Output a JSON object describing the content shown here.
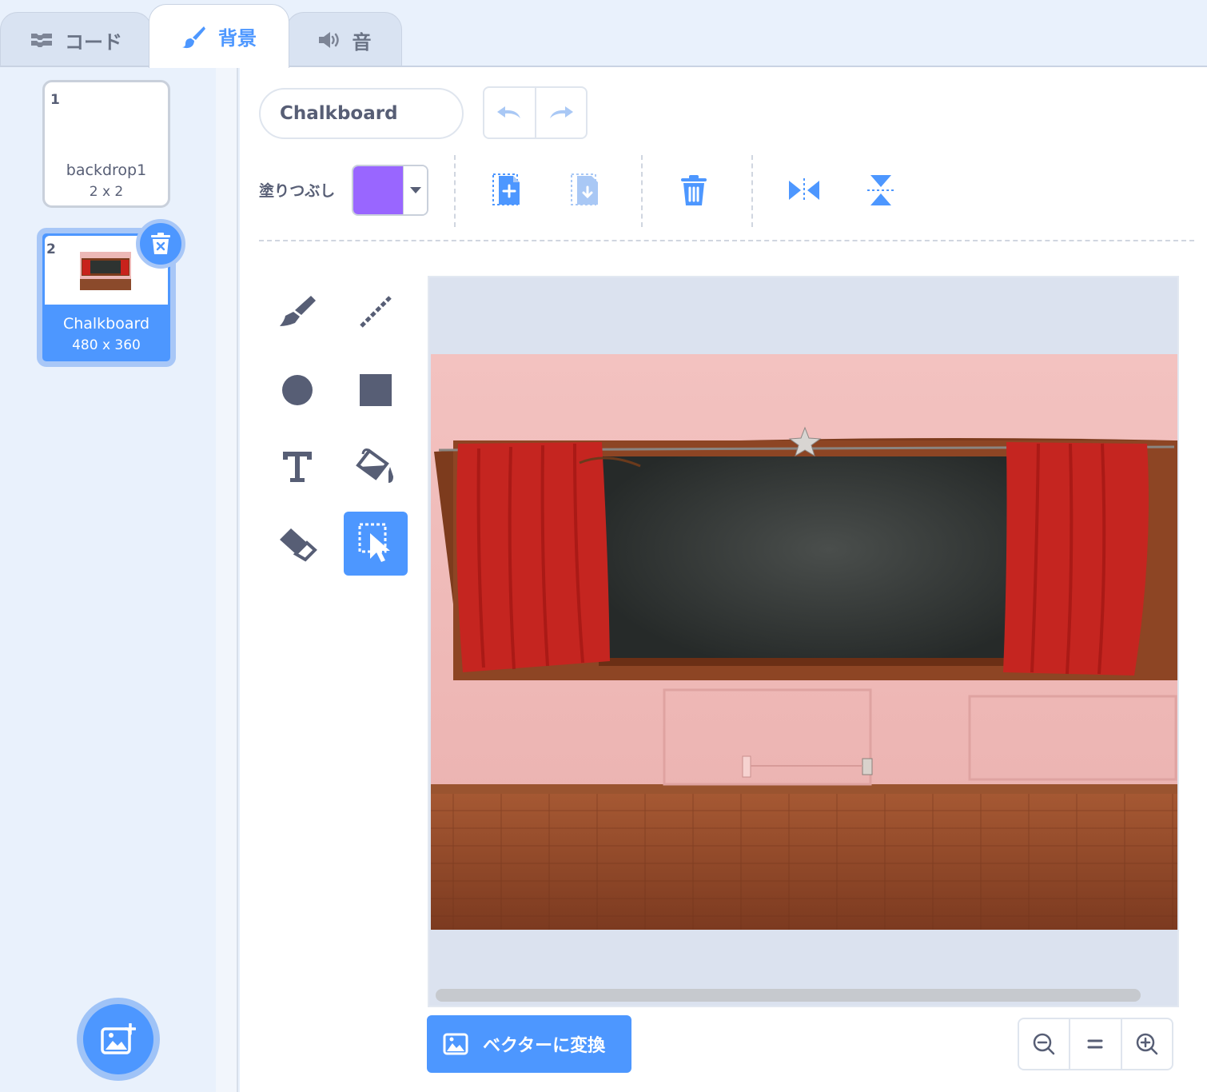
{
  "tabs": [
    {
      "label": "コード",
      "icon": "code-blocks-icon",
      "active": false
    },
    {
      "label": "背景",
      "icon": "paintbrush-icon",
      "active": true
    },
    {
      "label": "音",
      "icon": "speaker-icon",
      "active": false
    }
  ],
  "costumes": [
    {
      "number": "1",
      "name": "backdrop1",
      "size": "2 x 2",
      "selected": false
    },
    {
      "number": "2",
      "name": "Chalkboard",
      "size": "480 x 360",
      "selected": true
    }
  ],
  "editor": {
    "costume_name": "Chalkboard",
    "fill_label": "塗りつぶし",
    "fill_color": "#9966ff",
    "convert_button": "ベクターに変換",
    "selected_tool": "select"
  },
  "colors": {
    "accent": "#4d97ff",
    "tool_icon": "#575e75",
    "panel_bg": "#e9f1fc"
  }
}
